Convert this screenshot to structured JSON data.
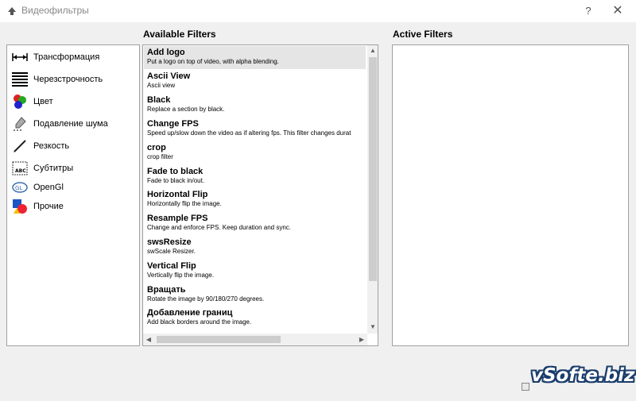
{
  "window": {
    "title": "Видеофильтры",
    "help_label": "?",
    "close_label": "✕"
  },
  "categories": [
    {
      "label": "Трансформация",
      "icon": "transform-arrows-icon"
    },
    {
      "label": "Черезстрочность",
      "icon": "interlace-lines-icon"
    },
    {
      "label": "Цвет",
      "icon": "color-balls-icon"
    },
    {
      "label": "Подавление шума",
      "icon": "noise-brush-icon"
    },
    {
      "label": "Резкость",
      "icon": "sharpness-pen-icon"
    },
    {
      "label": "Субтитры",
      "icon": "subtitles-abc-icon"
    },
    {
      "label": "OpenGl",
      "icon": "opengl-logo-icon"
    },
    {
      "label": "Прочие",
      "icon": "misc-shapes-icon"
    }
  ],
  "available": {
    "header": "Available Filters",
    "filters": [
      {
        "name": "Add logo",
        "desc": "Put a logo on top of video, with alpha blending."
      },
      {
        "name": "Ascii View",
        "desc": "Ascii view"
      },
      {
        "name": "Black",
        "desc": "Replace a section by black."
      },
      {
        "name": "Change FPS",
        "desc": "Speed up/slow down the video as if altering fps. This filter changes durat"
      },
      {
        "name": "crop",
        "desc": "crop filter"
      },
      {
        "name": "Fade to black",
        "desc": "Fade to black in/out."
      },
      {
        "name": "Horizontal Flip",
        "desc": "Horizontally flip the image."
      },
      {
        "name": "Resample FPS",
        "desc": "Change and enforce FPS. Keep duration and sync."
      },
      {
        "name": "swsResize",
        "desc": "swScale Resizer."
      },
      {
        "name": "Vertical Flip",
        "desc": "Vertically flip the image."
      },
      {
        "name": "Вращать",
        "desc": "Rotate the image by 90/180/270 degrees."
      },
      {
        "name": "Добавление границ",
        "desc": "Add black borders around the image."
      }
    ],
    "scroll_up": "▲",
    "scroll_down": "▼",
    "scroll_left": "◀",
    "scroll_right": "▶"
  },
  "active": {
    "header": "Active Filters"
  },
  "watermark": {
    "text": "vSofte.biz"
  }
}
